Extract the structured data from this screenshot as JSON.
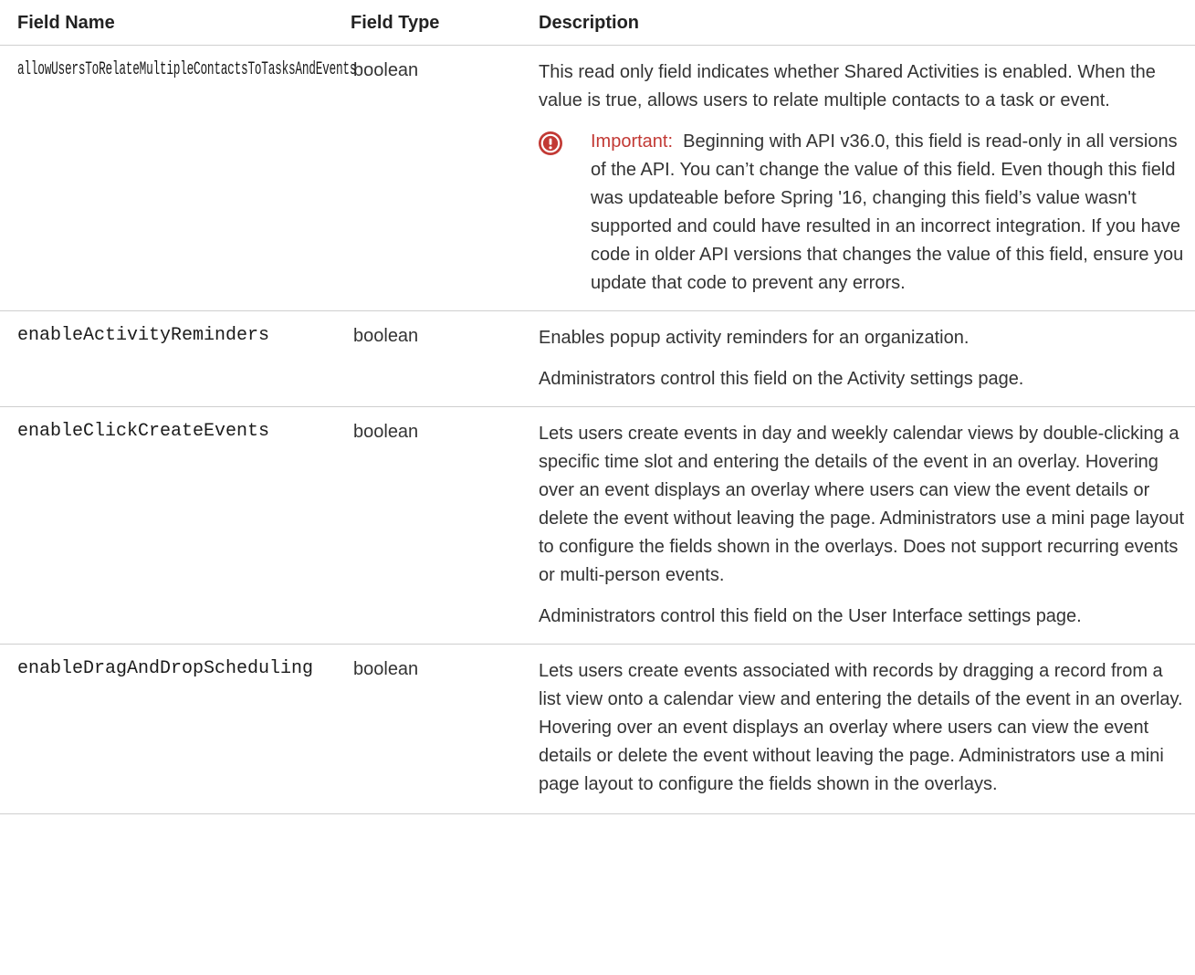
{
  "headers": {
    "field_name": "Field Name",
    "field_type": "Field Type",
    "description": "Description"
  },
  "rows": [
    {
      "name": "allowUsersToRelateMultipleContactsToTasksAndEvents",
      "type": "boolean",
      "paragraphs": [
        "This read only field indicates whether Shared Activities is enabled. When the value is true, allows users to relate multiple contacts to a task or event."
      ],
      "important": {
        "label": "Important:",
        "text": "Beginning with API v36.0, this field is read-only in all versions of the API. You can’t change the value of this field. Even though this field was updateable before Spring '16, changing this field’s value wasn't supported and could have resulted in an incorrect integration. If you have code in older API versions that changes the value of this field, ensure you update that code to prevent any errors."
      }
    },
    {
      "name": "enableActivityReminders",
      "type": "boolean",
      "paragraphs": [
        "Enables popup activity reminders for an organization.",
        "Administrators control this field on the Activity settings page."
      ]
    },
    {
      "name": "enableClickCreateEvents",
      "type": "boolean",
      "paragraphs": [
        "Lets users create events in day and weekly calendar views by double-clicking a specific time slot and entering the details of the event in an overlay. Hovering over an event displays an overlay where users can view the event details or delete the event without leaving the page. Administrators use a mini page layout to configure the fields shown in the overlays. Does not support recurring events or multi-person events.",
        "Administrators control this field on the User Interface settings page."
      ]
    },
    {
      "name": "enableDragAndDropScheduling",
      "type": "boolean",
      "paragraphs": [
        "Lets users create events associated with records by dragging a record from a list view onto a calendar view and entering the details of the event in an overlay. Hovering over an event displays an overlay where users can view the event details or delete the event without leaving the page. Administrators use a mini page layout to configure the fields shown in the overlays."
      ]
    }
  ],
  "colors": {
    "important_accent": "#c23934",
    "divider": "#cfcfcf"
  },
  "icons": {
    "important": "exclamation-circle-icon"
  }
}
